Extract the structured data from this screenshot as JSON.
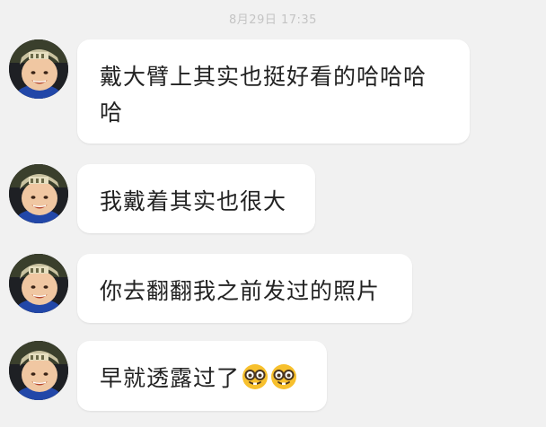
{
  "chat": {
    "timestamp": "8月29日 17:35",
    "messages": [
      {
        "text": "戴大臂上其实也挺好看的哈哈哈哈",
        "emojis": []
      },
      {
        "text": "我戴着其实也很大",
        "emojis": []
      },
      {
        "text": "你去翻翻我之前发过的照片",
        "emojis": []
      },
      {
        "text": "早就透露过了",
        "emojis": [
          "nerd-face-emoji",
          "nerd-face-emoji"
        ]
      }
    ]
  },
  "colors": {
    "background": "#f1f1f1",
    "bubble": "#ffffff",
    "text": "#222222",
    "timestamp": "#c4c4c4"
  }
}
